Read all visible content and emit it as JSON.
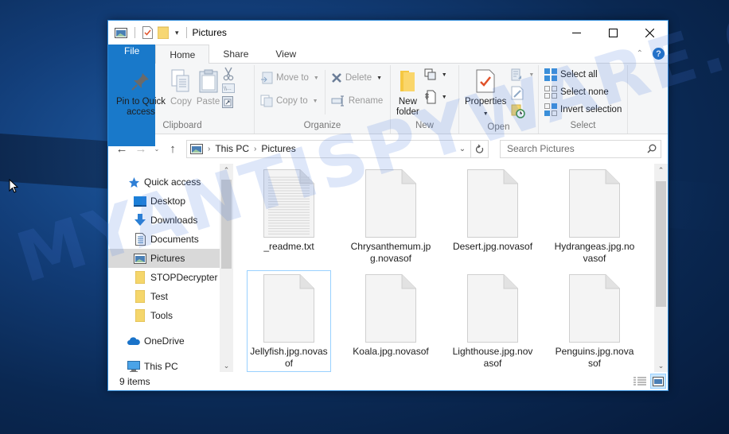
{
  "window": {
    "title": "Pictures",
    "controls": {
      "minimize": "minimize",
      "maximize": "maximize",
      "close": "close"
    }
  },
  "tabs": [
    {
      "label": "File"
    },
    {
      "label": "Home",
      "active": true
    },
    {
      "label": "Share"
    },
    {
      "label": "View"
    }
  ],
  "ribbon": {
    "clipboard": {
      "label": "Clipboard",
      "pin": "Pin to Quick access",
      "pin_line1": "Pin to Quick",
      "pin_line2": "access",
      "copy": "Copy",
      "paste": "Paste"
    },
    "organize": {
      "label": "Organize",
      "move_to": "Move to",
      "copy_to": "Copy to",
      "delete": "Delete",
      "rename": "Rename"
    },
    "new": {
      "label": "New",
      "new_folder_line1": "New",
      "new_folder_line2": "folder"
    },
    "open": {
      "label": "Open",
      "properties": "Properties"
    },
    "select": {
      "label": "Select",
      "select_all": "Select all",
      "select_none": "Select none",
      "invert_selection": "Invert selection"
    }
  },
  "address": {
    "breadcrumbs": [
      "This PC",
      "Pictures"
    ],
    "search_placeholder": "Search Pictures"
  },
  "sidebar": {
    "items": [
      {
        "label": "Quick access",
        "icon": "star-icon",
        "level": "top"
      },
      {
        "label": "Desktop",
        "icon": "desktop-icon",
        "level": "child",
        "pinned": true
      },
      {
        "label": "Downloads",
        "icon": "download-arrow-icon",
        "level": "child",
        "pinned": true
      },
      {
        "label": "Documents",
        "icon": "document-icon",
        "level": "child",
        "pinned": true
      },
      {
        "label": "Pictures",
        "icon": "pictures-icon",
        "level": "child",
        "selected": true
      },
      {
        "label": "STOPDecrypter",
        "icon": "folder-icon",
        "level": "child"
      },
      {
        "label": "Test",
        "icon": "folder-icon",
        "level": "child"
      },
      {
        "label": "Tools",
        "icon": "folder-icon",
        "level": "child"
      },
      {
        "label": "OneDrive",
        "icon": "cloud-icon",
        "level": "top"
      },
      {
        "label": "This PC",
        "icon": "computer-icon",
        "level": "top"
      }
    ]
  },
  "files": [
    {
      "name": "_readme.txt",
      "type": "text"
    },
    {
      "name": "Chrysanthemum.jpg.novasof",
      "type": "blank"
    },
    {
      "name": "Desert.jpg.novasof",
      "type": "blank"
    },
    {
      "name": "Hydrangeas.jpg.novasof",
      "type": "blank"
    },
    {
      "name": "Jellyfish.jpg.novasof",
      "type": "blank",
      "focused": true
    },
    {
      "name": "Koala.jpg.novasof",
      "type": "blank"
    },
    {
      "name": "Lighthouse.jpg.novasof",
      "type": "blank"
    },
    {
      "name": "Penguins.jpg.novasof",
      "type": "blank"
    }
  ],
  "status": {
    "item_count": "9 items"
  },
  "watermark": "MYANTISPYWARE.COM",
  "colors": {
    "accent": "#1979ca",
    "window_border": "#2b88d8",
    "selection": "#99d1ff"
  }
}
